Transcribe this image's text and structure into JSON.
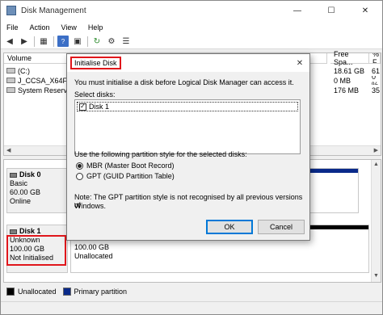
{
  "window": {
    "title": "Disk Management",
    "minimize": "—",
    "maximize": "☐",
    "close": "✕"
  },
  "menu": [
    "File",
    "Action",
    "View",
    "Help"
  ],
  "volumes": {
    "headers": {
      "volume": "Volume",
      "free_space": "Free Spa...",
      "pct": "% F"
    },
    "rows": [
      {
        "name": "(C:)",
        "free": "18.61 GB",
        "pct": "61"
      },
      {
        "name": "J_CCSA_X64FRE_",
        "free": "0 MB",
        "pct": "0 %"
      },
      {
        "name": "System Reserved",
        "free": "176 MB",
        "pct": "35"
      }
    ]
  },
  "disks": [
    {
      "title": "Disk 0",
      "type": "Basic",
      "size": "60.00 GB",
      "status": "Online"
    },
    {
      "title": "Disk 1",
      "type": "Unknown",
      "size": "100.00 GB",
      "status": "Not Initialised",
      "part_size": "100.00 GB",
      "part_status": "Unallocated"
    }
  ],
  "legend": {
    "unallocated": "Unallocated",
    "primary": "Primary partition"
  },
  "colors": {
    "highlight": "#e0161b",
    "primary_partition": "#0a2a8a",
    "unallocated": "#000000"
  },
  "dialog": {
    "title": "Initialise Disk",
    "message": "You must initialise a disk before Logical Disk Manager can access it.",
    "select_label": "Select disks:",
    "disk_item": "Disk 1",
    "partition_label": "Use the following partition style for the selected disks:",
    "mbr_label": "MBR (Master Boot Record)",
    "gpt_label": "GPT (GUID Partition Table)",
    "note_line1": "Note: The GPT partition style is not recognised by all previous versions of",
    "note_line2": "Windows.",
    "ok": "OK",
    "cancel": "Cancel"
  }
}
